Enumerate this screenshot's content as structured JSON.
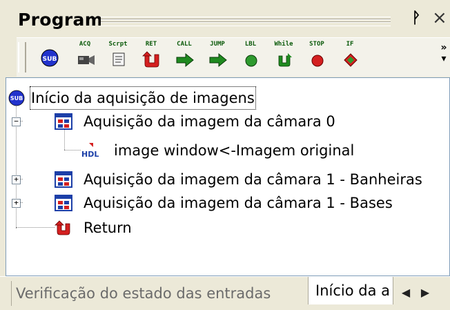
{
  "panel": {
    "title": "Program"
  },
  "toolbar": {
    "buttons": [
      {
        "label": "",
        "icon": "sub-icon"
      },
      {
        "label": "ACQ",
        "icon": "camera-icon"
      },
      {
        "label": "Scrpt",
        "icon": "script-icon"
      },
      {
        "label": "RET",
        "icon": "return-icon"
      },
      {
        "label": "CALL",
        "icon": "call-arrow-icon"
      },
      {
        "label": "JUMP",
        "icon": "jump-arrow-icon"
      },
      {
        "label": "LBL",
        "icon": "label-dot-icon"
      },
      {
        "label": "While",
        "icon": "while-loop-icon"
      },
      {
        "label": "STOP",
        "icon": "stop-icon"
      },
      {
        "label": "IF",
        "icon": "if-diamond-icon"
      }
    ],
    "more": "»"
  },
  "tree": {
    "root": "Início da aquisição de imagens",
    "items": [
      {
        "label": "Aquisição da imagem da câmara 0",
        "expander": "−"
      },
      {
        "label": "image window<-Imagem original",
        "badge": "HDL"
      },
      {
        "label": "Aquisição da imagem da câmara 1 - Banheiras",
        "expander": "+"
      },
      {
        "label": "Aquisição da imagem da câmara 1 - Bases",
        "expander": "+"
      },
      {
        "label": "Return"
      }
    ]
  },
  "tabs": {
    "inactive": "Verificação do estado das entradas",
    "active": "Início da a"
  },
  "colors": {
    "chrome": "#ece9d8",
    "tree_border": "#7f9db9",
    "sub_blue": "#2233cc",
    "green": "#1f8a1f",
    "red": "#d42020"
  }
}
